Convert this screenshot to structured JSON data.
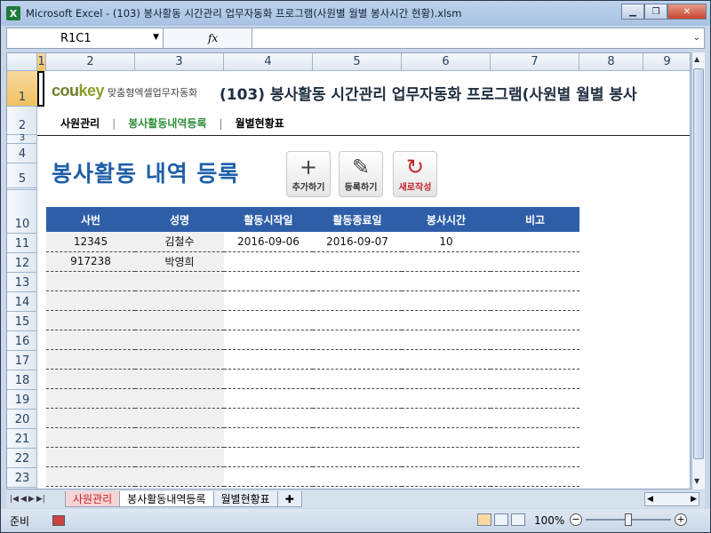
{
  "window": {
    "title": "Microsoft Excel - (103) 봉사활동 시간관리 업무자동화 프로그램(사원별 월별 봉사시간 현황).xlsm",
    "app_icon": "X"
  },
  "formula_bar": {
    "name_box": "R1C1",
    "fx_label": "fx",
    "value": ""
  },
  "columns": [
    "1",
    "2",
    "3",
    "4",
    "5",
    "6",
    "7",
    "8",
    "9"
  ],
  "rows": [
    "1",
    "2",
    "3",
    "4",
    "5",
    "10",
    "11",
    "12",
    "13",
    "14",
    "15",
    "16",
    "17",
    "18",
    "19",
    "20",
    "21",
    "22",
    "23"
  ],
  "sheet": {
    "logo_brand_a": "cou",
    "logo_brand_b": "key",
    "logo_sub": "맞춤형엑셀업무자동화",
    "title": "(103) 봉사활동 시간관리 업무자동화 프로그램(사원별 월별 봉사",
    "nav": [
      {
        "label": "사원관리"
      },
      {
        "label": "봉사활동내역등록"
      },
      {
        "label": "월별현황표"
      }
    ],
    "nav_sep": "|",
    "section_title": "봉사활동 내역 등록",
    "buttons": {
      "add": {
        "label": "추가하기",
        "icon": "+"
      },
      "register": {
        "label": "등록하기",
        "icon": "✎"
      },
      "reset": {
        "label": "새로작성",
        "icon": "↻"
      }
    },
    "table": {
      "headers": [
        "사번",
        "성명",
        "활동시작일",
        "활동종료일",
        "봉사시간",
        "비고"
      ],
      "rows": [
        [
          "12345",
          "김철수",
          "2016-09-06",
          "2016-09-07",
          "10",
          ""
        ],
        [
          "917238",
          "박영희",
          "",
          "",
          "",
          ""
        ],
        [
          "",
          "",
          "",
          "",
          "",
          ""
        ],
        [
          "",
          "",
          "",
          "",
          "",
          ""
        ],
        [
          "",
          "",
          "",
          "",
          "",
          ""
        ],
        [
          "",
          "",
          "",
          "",
          "",
          ""
        ],
        [
          "",
          "",
          "",
          "",
          "",
          ""
        ],
        [
          "",
          "",
          "",
          "",
          "",
          ""
        ],
        [
          "",
          "",
          "",
          "",
          "",
          ""
        ],
        [
          "",
          "",
          "",
          "",
          "",
          ""
        ],
        [
          "",
          "",
          "",
          "",
          "",
          ""
        ],
        [
          "",
          "",
          "",
          "",
          "",
          ""
        ],
        [
          "",
          "",
          "",
          "",
          "",
          ""
        ]
      ]
    }
  },
  "tabs": [
    {
      "label": "사원관리"
    },
    {
      "label": "봉사활동내역등록"
    },
    {
      "label": "월별현황표"
    }
  ],
  "status": {
    "ready": "준비",
    "zoom": "100%"
  },
  "colors": {
    "header_blue": "#2e5ea8",
    "title_blue": "#1f5fa8",
    "active_green": "#2f8f3a",
    "reset_red": "#c0252a"
  }
}
